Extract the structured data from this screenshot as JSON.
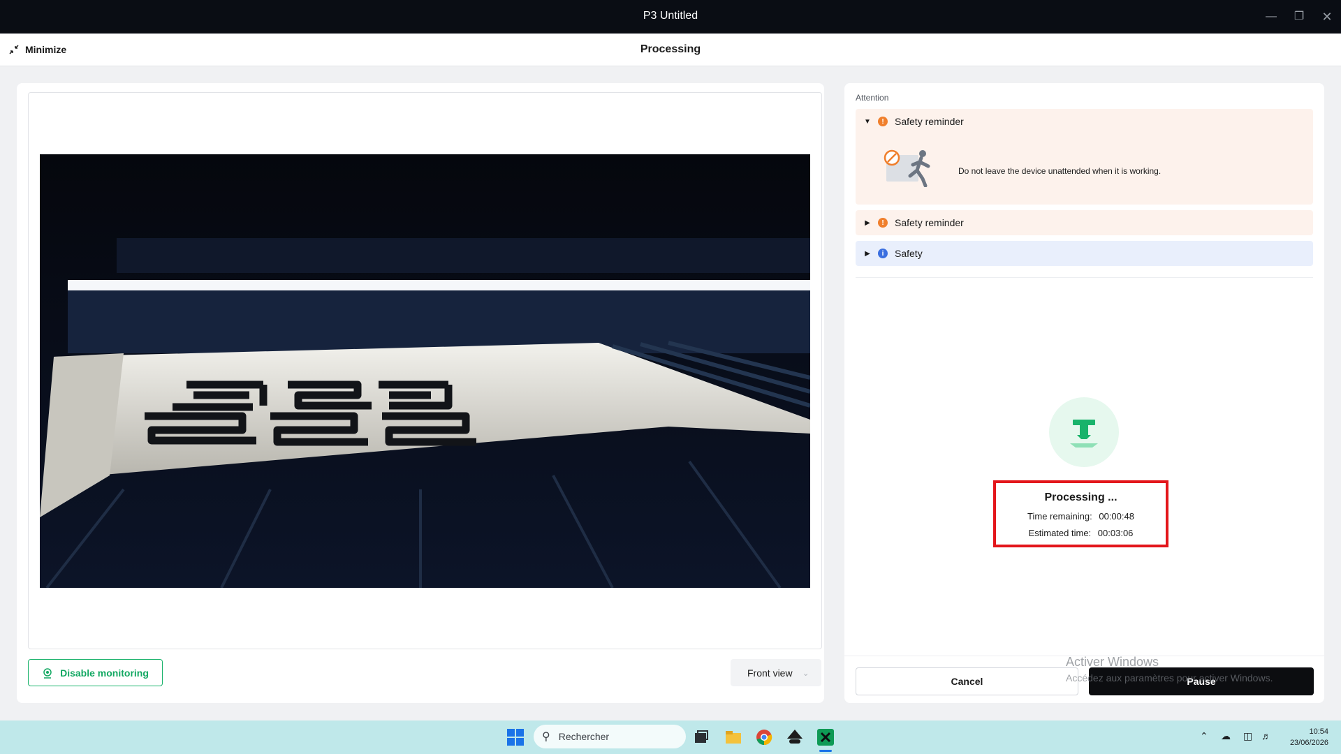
{
  "window": {
    "title": "P3 Untitled",
    "controls": [
      "minimize-icon",
      "restore-icon",
      "close-icon"
    ]
  },
  "header": {
    "minimize_label": "Minimize",
    "title": "Processing"
  },
  "monitor": {
    "disable_label": "Disable monitoring",
    "view_select": "Front view"
  },
  "attention": {
    "label": "Attention",
    "items": [
      {
        "title": "Safety reminder",
        "severity": "warning",
        "expanded": true,
        "message": "Do not leave the device unattended when it is working."
      },
      {
        "title": "Safety reminder",
        "severity": "warning",
        "expanded": false
      },
      {
        "title": "Safety",
        "severity": "info",
        "expanded": false
      }
    ]
  },
  "status": {
    "title": "Processing ...",
    "time_remaining_label": "Time remaining:",
    "time_remaining": "00:00:48",
    "estimated_label": "Estimated time:",
    "estimated": "00:03:06"
  },
  "actions": {
    "cancel": "Cancel",
    "pause": "Pause"
  },
  "watermark": {
    "line1": "Activer Windows",
    "line2": "Accédez aux paramètres pour activer Windows."
  },
  "taskbar": {
    "search_placeholder": "Rechercher",
    "time": "10:54",
    "date": "23/06/2026"
  },
  "colors": {
    "accent_green": "#19b36b",
    "warning_orange": "#f07f2c",
    "info_blue": "#3b6fe0",
    "highlight_red": "#e3161b"
  }
}
